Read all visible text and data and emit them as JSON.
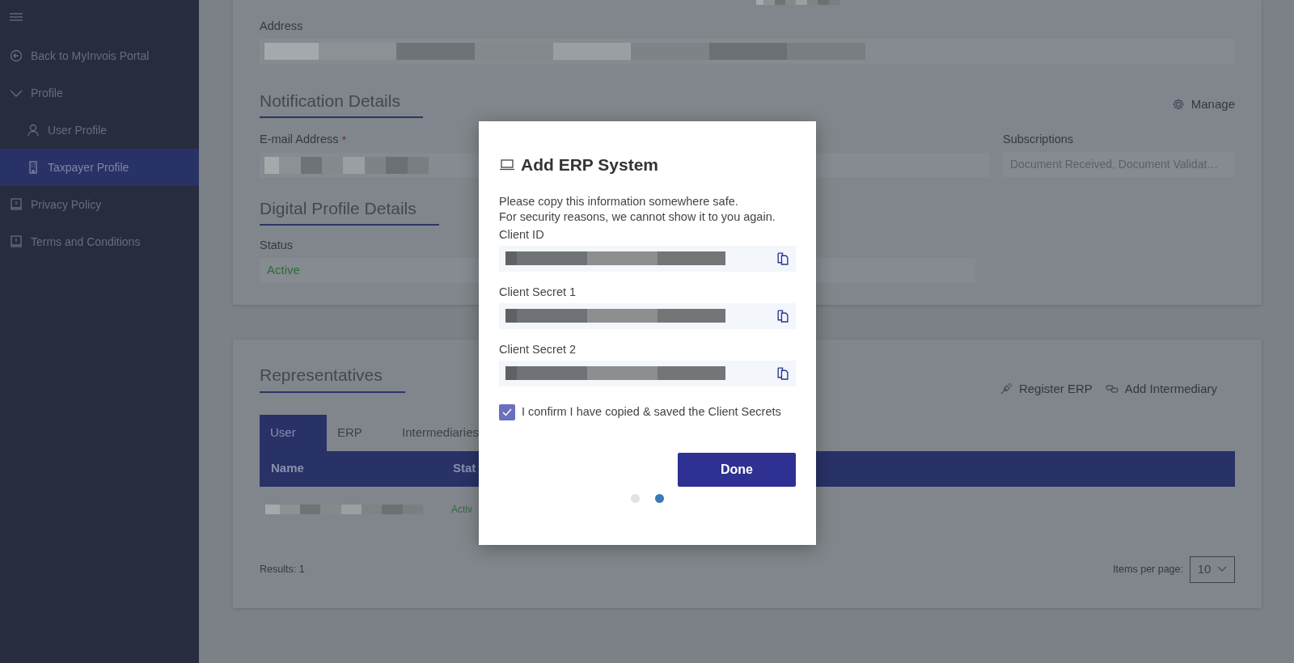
{
  "sidebar": {
    "items": [
      {
        "label": "Back to MyInvois Portal",
        "kind": "back",
        "selected": false
      },
      {
        "label": "Profile",
        "kind": "group",
        "expanded": true,
        "selected": false,
        "children": [
          {
            "label": "User Profile",
            "kind": "user",
            "selected": false
          },
          {
            "label": "Taxpayer Profile",
            "kind": "building",
            "selected": true
          }
        ]
      },
      {
        "label": "Privacy Policy",
        "kind": "book",
        "selected": false
      },
      {
        "label": "Terms and Conditions",
        "kind": "book",
        "selected": false
      }
    ]
  },
  "details_card": {
    "address": {
      "label": "Address"
    },
    "notification": {
      "heading": "Notification Details",
      "manage": "Manage",
      "email": {
        "label": "E-mail Address",
        "required_mark": "*"
      },
      "subscriptions": {
        "label": "Subscriptions",
        "value": "Document Received, Document Validat…",
        "disabled": true
      }
    },
    "digital_profile": {
      "heading": "Digital Profile Details",
      "status": {
        "label": "Status",
        "value": "Active"
      }
    }
  },
  "representatives": {
    "heading": "Representatives",
    "actions": [
      {
        "label": "Register ERP",
        "kind": "plug"
      },
      {
        "label": "Add Intermediary",
        "kind": "link"
      }
    ],
    "tabs": [
      {
        "label": "User",
        "selected": true
      },
      {
        "label": "ERP",
        "selected": false
      },
      {
        "label": "Intermediaries",
        "selected": false
      }
    ],
    "table": {
      "columns": [
        "Name",
        "Stat"
      ],
      "rows": [
        {
          "status": "Activ"
        }
      ]
    },
    "results": "Results: 1",
    "items_per_page": {
      "label": "Items per page:",
      "value": "10"
    }
  },
  "modal": {
    "title": "Add ERP System",
    "lines": [
      "Please copy this information somewhere safe.",
      "For security reasons, we cannot show it to you again."
    ],
    "fields": [
      {
        "label": "Client ID"
      },
      {
        "label": "Client Secret 1"
      },
      {
        "label": "Client Secret 2"
      }
    ],
    "confirm": {
      "label": "I confirm I have copied & saved the Client Secrets",
      "checked": true
    },
    "button": "Done",
    "steps": [
      {
        "selected": false
      },
      {
        "selected": true
      }
    ]
  }
}
